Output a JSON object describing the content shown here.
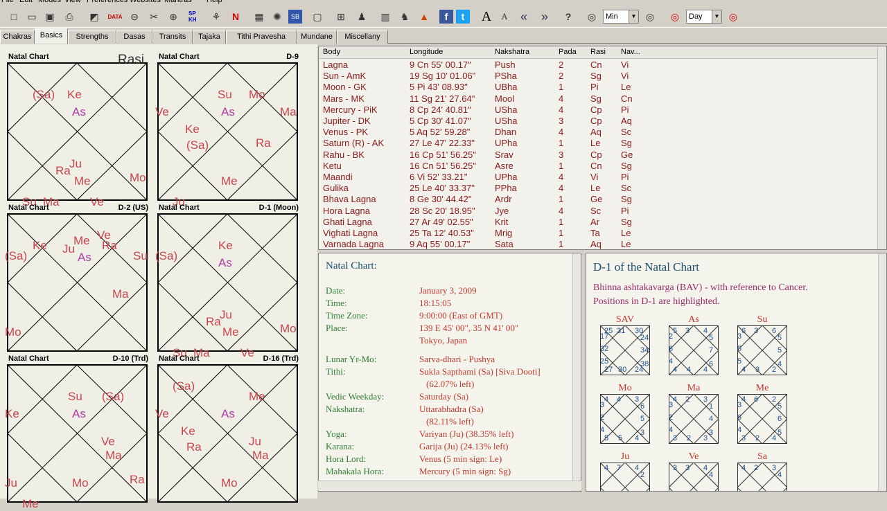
{
  "menu": [
    "File",
    "Edit",
    "Modes",
    "View",
    "Preferences",
    "Websites",
    "Mantras",
    "Help"
  ],
  "toolbar": {
    "combo1": "Min",
    "combo2": "Day",
    "data_label": "DATA",
    "spkh_label": "SP KH",
    "n_label": "N",
    "sb_label": "SB",
    "big_a": "A",
    "small_a": "A"
  },
  "tabs": [
    "Chakras",
    "Basics",
    "Strengths",
    "Dasas",
    "Transits",
    "Tajaka",
    "Tithi Pravesha",
    "Mundane",
    "Miscellany"
  ],
  "active_tab": "Basics",
  "rasi_label": "Rasi",
  "charts": [
    {
      "title": "Natal Chart",
      "division": "",
      "glyphs": [
        "(Sa)",
        "Ke",
        "As",
        "Ju",
        "Ra",
        "Me",
        "Mo",
        "Su",
        "Ma",
        "Ve"
      ]
    },
    {
      "title": "Natal Chart",
      "division": "D-9",
      "glyphs": [
        "Su",
        "Mo",
        "As",
        "Ma",
        "Ve",
        "Ke",
        "(Sa)",
        "Ra",
        "Me",
        "Ju"
      ]
    },
    {
      "title": "Natal Chart",
      "division": "D-2 (US)",
      "glyphs": [
        "Ke",
        "Ve",
        "Ju",
        "Me",
        "As",
        "Ra",
        "(Sa)",
        "Su",
        "Ma",
        "Mo"
      ]
    },
    {
      "title": "Natal Chart",
      "division": "D-1 (Moon)",
      "glyphs": [
        "Ke",
        "As",
        "(Sa)",
        "Ju",
        "Ra",
        "Me",
        "Mo",
        "Su",
        "Ma",
        "Ve"
      ]
    },
    {
      "title": "Natal Chart",
      "division": "D-10 (Trd)",
      "glyphs": [
        "Su",
        "(Sa)",
        "As",
        "Ke",
        "Ve",
        "Ma",
        "Mo",
        "Ra",
        "Ju",
        "Me"
      ]
    },
    {
      "title": "Natal Chart",
      "division": "D-16 (Trd)",
      "glyphs": [
        "(Sa)",
        "Me",
        "As",
        "Ve",
        "Ke",
        "Ra",
        "Ju",
        "Ma",
        "Mo"
      ]
    }
  ],
  "planet_table": {
    "headers": [
      "Body",
      "Longitude",
      "Nakshatra",
      "Pada",
      "Rasi",
      "Nav..."
    ],
    "rows": [
      [
        "Lagna",
        "9 Cn 55' 00.17\"",
        "Push",
        "2",
        "Cn",
        "Vi"
      ],
      [
        "Sun - AmK",
        "19 Sg 10' 01.06\"",
        "PSha",
        "2",
        "Sg",
        "Vi"
      ],
      [
        "Moon - GK",
        "5 Pi 43' 08.93\"",
        "UBha",
        "1",
        "Pi",
        "Le"
      ],
      [
        "Mars - MK",
        "11 Sg 21' 27.64\"",
        "Mool",
        "4",
        "Sg",
        "Cn"
      ],
      [
        "Mercury - PiK",
        "8 Cp 24' 40.81\"",
        "USha",
        "4",
        "Cp",
        "Pi"
      ],
      [
        "Jupiter - DK",
        "5 Cp 30' 41.07\"",
        "USha",
        "3",
        "Cp",
        "Aq"
      ],
      [
        "Venus - PK",
        "5 Aq 52' 59.28\"",
        "Dhan",
        "4",
        "Aq",
        "Sc"
      ],
      [
        "Saturn (R) - AK",
        "27 Le 47' 22.33\"",
        "UPha",
        "1",
        "Le",
        "Sg"
      ],
      [
        "Rahu - BK",
        "16 Cp 51' 56.25\"",
        "Srav",
        "3",
        "Cp",
        "Ge"
      ],
      [
        "Ketu",
        "16 Cn 51' 56.25\"",
        "Asre",
        "1",
        "Cn",
        "Sg"
      ],
      [
        "Maandi",
        "6 Vi 52' 33.21\"",
        "UPha",
        "4",
        "Vi",
        "Pi"
      ],
      [
        "Gulika",
        "25 Le 40' 33.37\"",
        "PPha",
        "4",
        "Le",
        "Sc"
      ],
      [
        "Bhava Lagna",
        "8 Ge 30' 44.42\"",
        "Ardr",
        "1",
        "Ge",
        "Sg"
      ],
      [
        "Hora Lagna",
        "28 Sc 20' 18.95\"",
        "Jye",
        "4",
        "Sc",
        "Pi"
      ],
      [
        "Ghati Lagna",
        "27 Ar 49' 02.55\"",
        "Krit",
        "1",
        "Ar",
        "Sg"
      ],
      [
        "Vighati Lagna",
        "25 Ta 12' 40.53\"",
        "Mrig",
        "1",
        "Ta",
        "Le"
      ],
      [
        "Varnada Lagna",
        "9 Aq 55' 00.17\"",
        "Sata",
        "1",
        "Aq",
        "Le"
      ]
    ]
  },
  "details": {
    "title": "Natal Chart:",
    "items": [
      {
        "label": "Date:",
        "value": "January 3, 2009"
      },
      {
        "label": "Time:",
        "value": "18:15:05"
      },
      {
        "label": "Time Zone:",
        "value": "9:00:00 (East of GMT)"
      },
      {
        "label": "Place:",
        "value": "139 E 45' 00\", 35 N 41' 00\""
      },
      {
        "label": "",
        "value": "Tokyo, Japan"
      },
      {
        "label": "Lunar Yr-Mo:",
        "value": "Sarva-dhari - Pushya"
      },
      {
        "label": "Tithi:",
        "value": "Sukla Sapthami (Sa) [Siva Dooti]"
      },
      {
        "label": "",
        "value": "(62.07% left)"
      },
      {
        "label": "Vedic Weekday:",
        "value": "Saturday (Sa)"
      },
      {
        "label": "Nakshatra:",
        "value": "Uttarabhadra (Sa)"
      },
      {
        "label": "",
        "value": "(82.11% left)"
      },
      {
        "label": "Yoga:",
        "value": "Variyan (Ju) (38.35% left)"
      },
      {
        "label": "Karana:",
        "value": "Garija (Ju) (24.13% left)"
      },
      {
        "label": "Hora Lord:",
        "value": "Venus (5 min sign: Le)"
      },
      {
        "label": "Mahakala Hora:",
        "value": "Mercury (5 min sign: Sg)"
      }
    ]
  },
  "bav": {
    "title": "D-1 of the Natal Chart",
    "subtitle1": "Bhinna ashtakavarga (BAV) - with reference to Cancer.",
    "subtitle2": "Positions in D-1 are highlighted.",
    "grids": [
      {
        "name": "SAV",
        "nums": [
          "25",
          "31",
          "30",
          "24",
          "34",
          "38",
          "24",
          "30",
          "27",
          "25",
          "32",
          "17"
        ]
      },
      {
        "name": "As",
        "nums": [
          "5",
          "3",
          "4",
          "5",
          "7",
          "6",
          "4",
          "4",
          "4",
          "4",
          "6",
          "2"
        ]
      },
      {
        "name": "Su",
        "nums": [
          "6",
          "3",
          "6",
          "5",
          "5",
          "4",
          "2",
          "3",
          "4",
          "5",
          "5",
          "3"
        ]
      },
      {
        "name": "Mo",
        "nums": [
          "4",
          "4",
          "3",
          "6",
          "5",
          "3",
          "4",
          "5",
          "5",
          "4",
          "2",
          "3"
        ]
      },
      {
        "name": "Ma",
        "nums": [
          "4",
          "2",
          "3",
          "1",
          "4",
          "3",
          "3",
          "2",
          "3",
          "4",
          "2",
          "3"
        ]
      },
      {
        "name": "Me",
        "nums": [
          "4",
          "6",
          "2",
          "5",
          "6",
          "5",
          "4",
          "2",
          "3",
          "4",
          "6",
          "3"
        ]
      },
      {
        "name": "Ju",
        "nums": [
          "4",
          "7",
          "4",
          "2"
        ]
      },
      {
        "name": "Ve",
        "nums": [
          "3",
          "3",
          "4",
          "4"
        ]
      },
      {
        "name": "Sa",
        "nums": [
          "4",
          "2",
          "3",
          "4"
        ]
      }
    ]
  }
}
